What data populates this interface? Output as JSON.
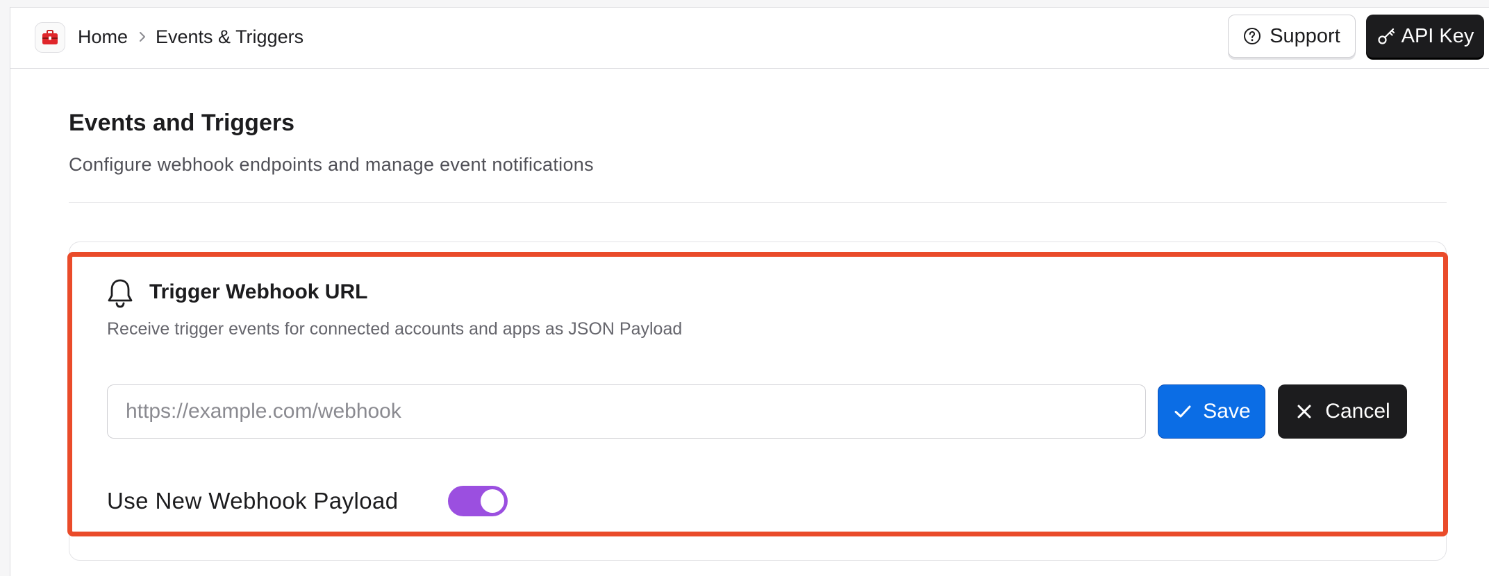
{
  "breadcrumb": {
    "home": "Home",
    "current": "Events & Triggers"
  },
  "header": {
    "support_label": "Support",
    "api_key_label": "API Key"
  },
  "page": {
    "title": "Events and Triggers",
    "subtitle": "Configure webhook endpoints and manage event notifications"
  },
  "webhook": {
    "title": "Trigger Webhook URL",
    "description": "Receive trigger events for connected accounts and apps as JSON Payload",
    "url_value": "",
    "url_placeholder": "https://example.com/webhook",
    "save_label": "Save",
    "cancel_label": "Cancel",
    "toggle_label": "Use New Webhook Payload",
    "toggle_on": true
  },
  "colors": {
    "accent_blue": "#0b6de5",
    "highlight_red": "#ea4b2a",
    "toggle_purple": "#9b4fe0",
    "dark": "#1c1c1e"
  },
  "icons": {
    "logo": "toolbox-icon",
    "breadcrumb_separator": "chevron-right-icon",
    "support": "question-circle-icon",
    "api_key": "key-icon",
    "section": "bell-icon",
    "save": "check-icon",
    "cancel": "close-icon"
  }
}
